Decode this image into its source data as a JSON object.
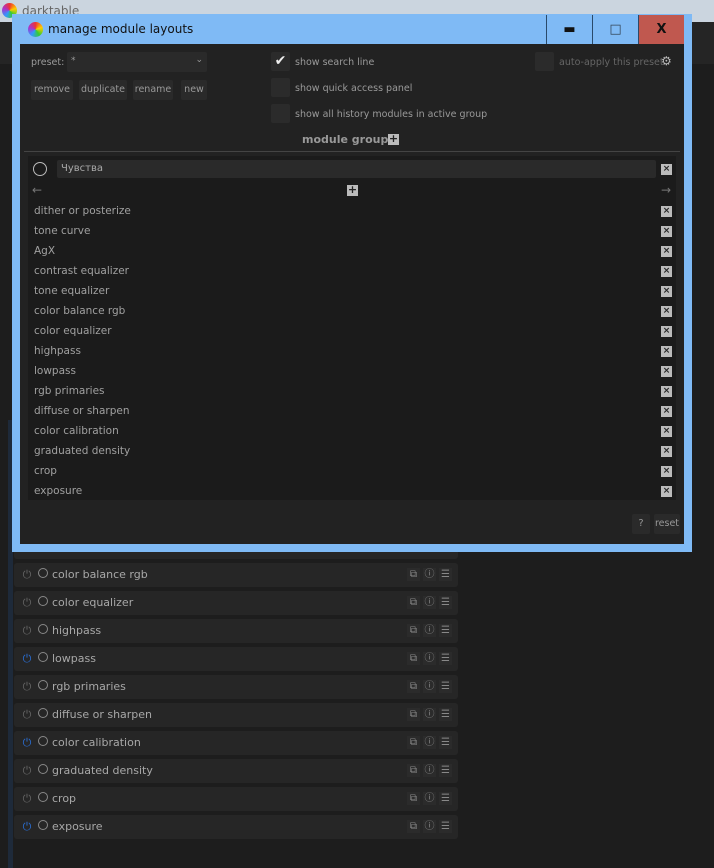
{
  "app": {
    "title": "darktable"
  },
  "dialog": {
    "title": "manage module layouts",
    "buttons": {
      "minimize": "▬",
      "maximize": "□",
      "close": "X"
    },
    "preset_label": "preset:",
    "preset_value": "*",
    "actions": [
      "remove",
      "duplicate",
      "rename",
      "new"
    ],
    "options": [
      {
        "label": "show search line",
        "checked": true
      },
      {
        "label": "show quick access panel",
        "checked": false
      },
      {
        "label": "show all history modules in active group",
        "checked": false
      }
    ],
    "auto_apply": "auto-apply this preset",
    "module_groups": "module groups",
    "group_name": "Чувства",
    "modules": [
      "dither or posterize",
      "tone curve",
      "AgX",
      "contrast equalizer",
      "tone equalizer",
      "color balance rgb",
      "color equalizer",
      "highpass",
      "lowpass",
      "rgb primaries",
      "diffuse or sharpen",
      "color calibration",
      "graduated density",
      "crop",
      "exposure"
    ],
    "help": "?",
    "reset": "reset"
  },
  "background_modules": [
    {
      "name": "color balance rgb",
      "on": false
    },
    {
      "name": "color equalizer",
      "on": false
    },
    {
      "name": "highpass",
      "on": false
    },
    {
      "name": "lowpass",
      "on": true
    },
    {
      "name": "rgb primaries",
      "on": false
    },
    {
      "name": "diffuse or sharpen",
      "on": false
    },
    {
      "name": "color calibration",
      "on": true
    },
    {
      "name": "graduated density",
      "on": false
    },
    {
      "name": "crop",
      "on": false
    },
    {
      "name": "exposure",
      "on": true
    }
  ],
  "colors": {
    "accent": "#7fbaf5",
    "close": "#c0584f",
    "power_on": "#2a6fd6"
  }
}
